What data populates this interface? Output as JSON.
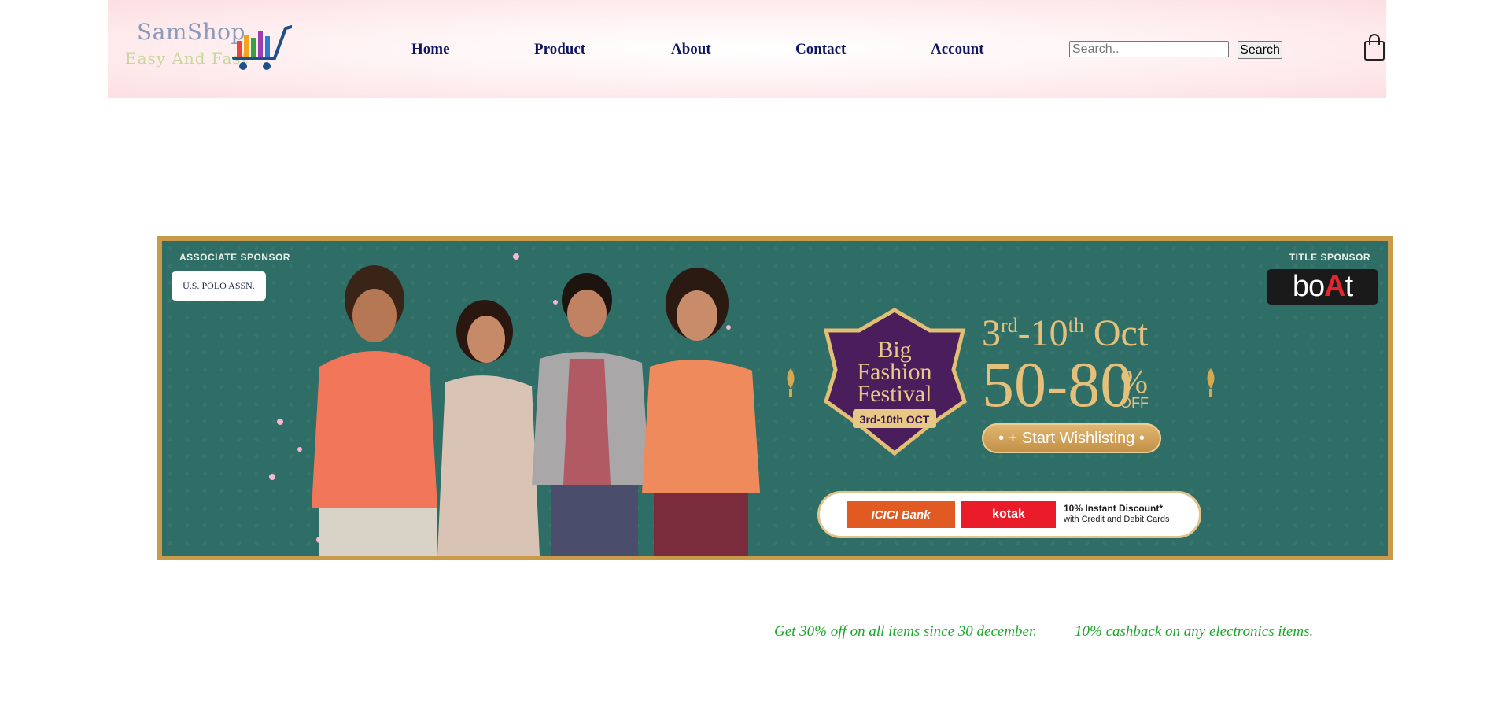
{
  "logo": {
    "name": "SamShop",
    "tagline": "Easy And Fast"
  },
  "nav": {
    "home": "Home",
    "product": "Product",
    "about": "About",
    "contact": "Contact",
    "account": "Account"
  },
  "search": {
    "placeholder": "Search..",
    "button_label": "Search"
  },
  "icons": {
    "cart": "shopping-cart-icon",
    "bag": "shopping-bag-icon"
  },
  "banner": {
    "associate_sponsor_label": "ASSOCIATE SPONSOR",
    "associate_sponsor": "U.S. POLO ASSN.",
    "title_sponsor_label": "TITLE SPONSOR",
    "title_sponsor_pre": "bo",
    "title_sponsor_accent": "A",
    "title_sponsor_post": "t",
    "festival_line1": "Big",
    "festival_line2": "Fashion",
    "festival_line3": "Festival",
    "festival_dates": "3rd-10th OCT",
    "dates_start": "3",
    "dates_start_sup": "rd",
    "dates_end": "-10",
    "dates_end_sup": "th",
    "dates_month": " Oct",
    "discount": "50-80",
    "discount_pct": "%",
    "discount_off": "OFF",
    "wishlist_label": "• + Start Wishlisting •",
    "bank1": "ICICI Bank",
    "bank1_sub": "Credit & Debit Cards",
    "bank2": "kotak",
    "bank2_sub": "Credit & Debit Cards",
    "bank_offer": "10% Instant Discount*",
    "bank_offer_sub": "with Credit and Debit Cards"
  },
  "offers": {
    "offer1": "Get 30% off on all items since 30 december.",
    "offer2": "10% cashback on any electronics items."
  },
  "colors": {
    "nav_text": "#0e1660",
    "offer_text": "#1aa828",
    "banner_bg": "#2f6d67",
    "banner_gold": "#c99a48"
  }
}
